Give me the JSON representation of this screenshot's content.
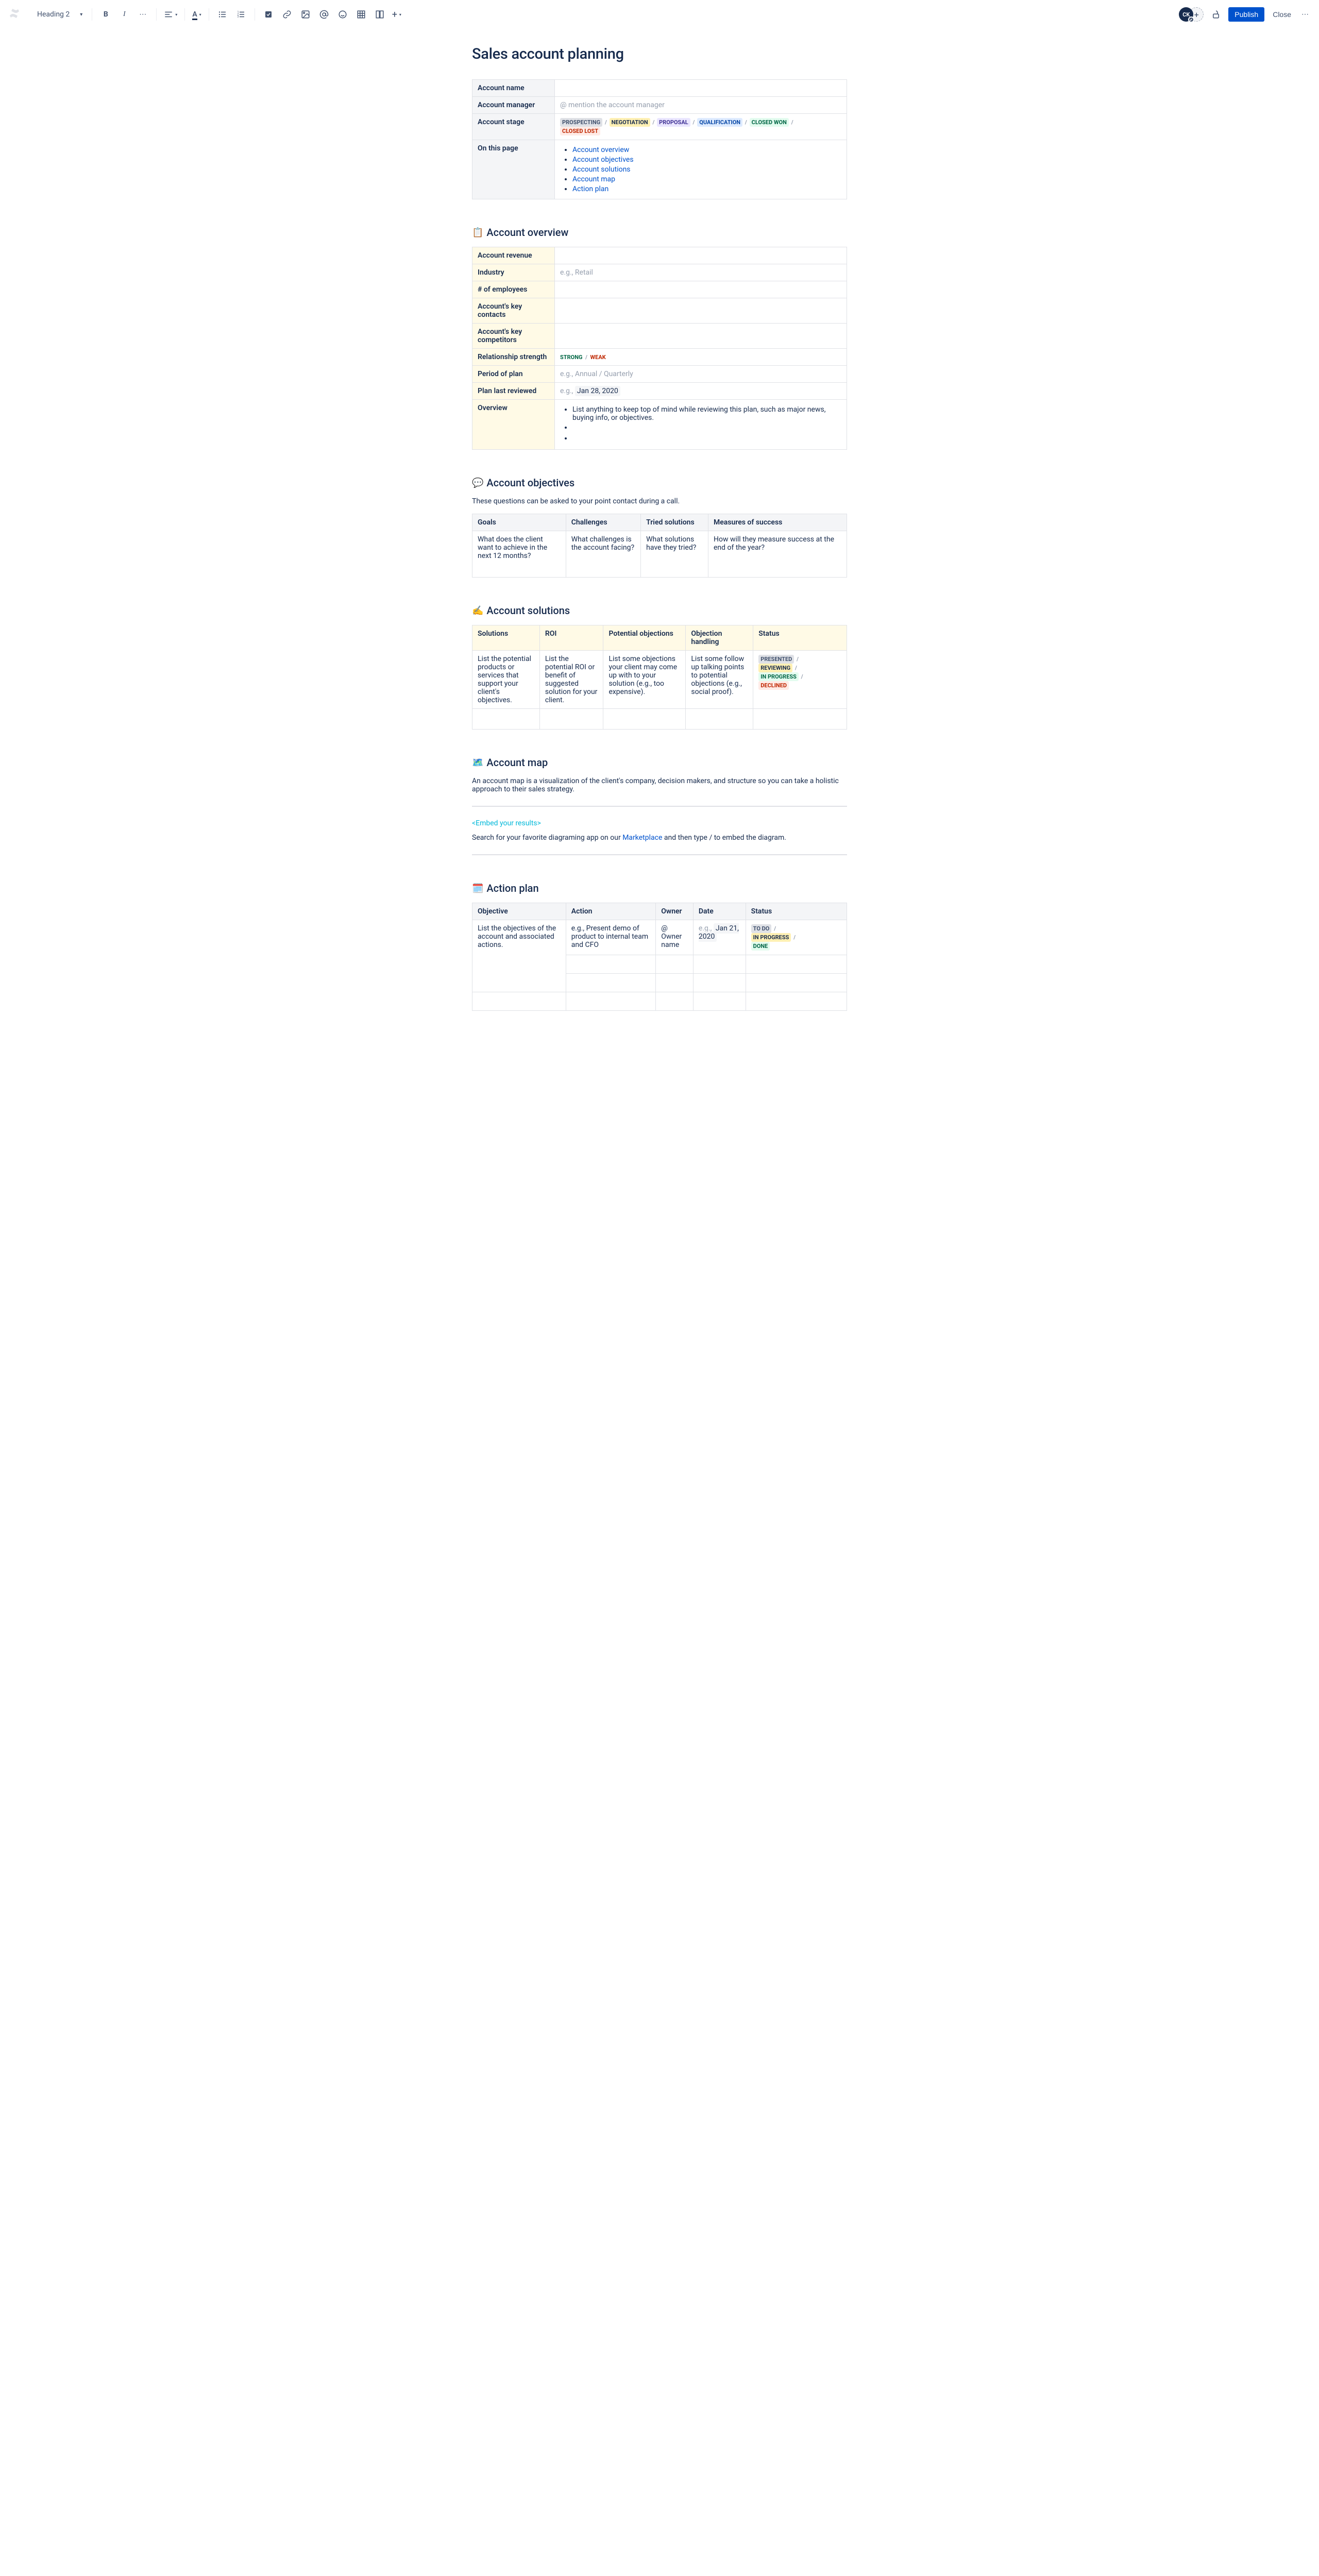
{
  "toolbar": {
    "heading_select": "Heading 2",
    "publish": "Publish",
    "close": "Close",
    "avatar_initials": "CK"
  },
  "page": {
    "title": "Sales account planning"
  },
  "meta_table": {
    "rows": {
      "account_name": {
        "label": "Account name",
        "value": ""
      },
      "account_manager": {
        "label": "Account manager",
        "placeholder": "@ mention the account manager"
      },
      "account_stage": {
        "label": "Account stage"
      },
      "on_this_page": {
        "label": "On this page"
      }
    },
    "stages": [
      {
        "text": "PROSPECTING",
        "cls": "loz-neutral"
      },
      {
        "text": "NEGOTIATION",
        "cls": "loz-yellow"
      },
      {
        "text": "PROPOSAL",
        "cls": "loz-purple"
      },
      {
        "text": "QUALIFICATION",
        "cls": "loz-blue"
      },
      {
        "text": "CLOSED WON",
        "cls": "loz-green"
      },
      {
        "text": "CLOSED LOST",
        "cls": "loz-red"
      }
    ],
    "toc": [
      "Account overview",
      "Account objectives",
      "Account solutions",
      "Account map",
      "Action plan"
    ]
  },
  "overview_section": {
    "title": "Account overview",
    "emoji": "📋",
    "rows": {
      "revenue": {
        "label": "Account revenue",
        "value": ""
      },
      "industry": {
        "label": "Industry",
        "placeholder": "e.g., Retail"
      },
      "employees": {
        "label": "# of employees",
        "value": ""
      },
      "contacts": {
        "label": "Account's key contacts",
        "value": ""
      },
      "competitors": {
        "label": "Account's key competitors",
        "value": ""
      },
      "relationship": {
        "label": "Relationship strength",
        "strong": "STRONG",
        "weak": "WEAK"
      },
      "period": {
        "label": "Period of plan",
        "placeholder": "e.g., Annual / Quarterly"
      },
      "last_reviewed": {
        "label": "Plan last reviewed",
        "prefix": "e.g., ",
        "date": "Jan 28, 2020"
      },
      "overview": {
        "label": "Overview",
        "bullet": "List anything to keep top of mind while reviewing this plan, such as major news, buying info, or objectives."
      }
    }
  },
  "objectives_section": {
    "title": "Account objectives",
    "emoji": "💬",
    "desc": "These questions can be asked to your point contact during a call.",
    "headers": [
      "Goals",
      "Challenges",
      "Tried solutions",
      "Measures of success"
    ],
    "row": [
      "What does the client want to achieve in the next 12 months?",
      "What challenges is the account facing?",
      "What solutions have they tried?",
      "How will they measure success at the end of the year?"
    ]
  },
  "solutions_section": {
    "title": "Account solutions",
    "emoji": "✍️",
    "headers": [
      "Solutions",
      "ROI",
      "Potential objections",
      "Objection handling",
      "Status"
    ],
    "row": [
      "List the potential products or services that support your client's objectives.",
      "List the potential ROI or benefit of suggested solution for your client.",
      "List some objections your client may come up with to your solution (e.g., too expensive).",
      "List some follow up talking points to potential objections (e.g., social proof)."
    ],
    "statuses": [
      {
        "text": "PRESENTED",
        "cls": "loz-neutral"
      },
      {
        "text": "REVIEWING",
        "cls": "loz-yellow"
      },
      {
        "text": "IN PROGRESS",
        "cls": "loz-green"
      },
      {
        "text": "DECLINED",
        "cls": "loz-red"
      }
    ]
  },
  "map_section": {
    "title": "Account map",
    "emoji": "🗺️",
    "desc": "An account map is a visualization of the client's company, decision makers, and structure so you can take a holistic approach to their sales strategy.",
    "embed_placeholder": "<Embed your results>",
    "search_prefix": "Search for your favorite diagraming app on our ",
    "marketplace": "Marketplace",
    "search_suffix": " and then type / to embed the diagram."
  },
  "action_section": {
    "title": "Action plan",
    "emoji": "🗓️",
    "headers": [
      "Objective",
      "Action",
      "Owner",
      "Date",
      "Status"
    ],
    "objective_cell": "List the objectives of the account and associated actions.",
    "action_cell": "e.g., Present demo of product to internal team and CFO",
    "owner_cell": "@ Owner name",
    "date_prefix": "e.g., ",
    "date_value": "Jan 21, 2020",
    "statuses": [
      {
        "text": "TO DO",
        "cls": "loz-neutral"
      },
      {
        "text": "IN PROGRESS",
        "cls": "loz-yellow"
      },
      {
        "text": "DONE",
        "cls": "loz-green"
      }
    ]
  }
}
